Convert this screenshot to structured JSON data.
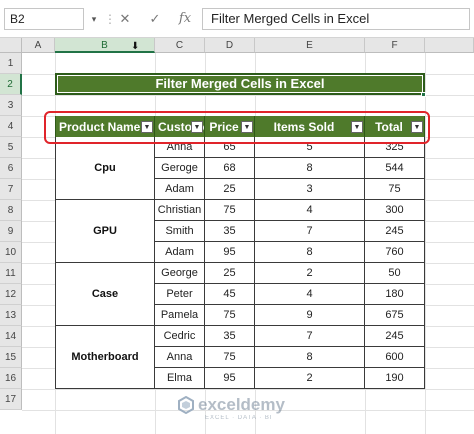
{
  "formula_bar": {
    "name_box": "B2",
    "cancel_symbol": "✕",
    "enter_symbol": "✓",
    "fx_symbol": "fx",
    "formula": "Filter Merged Cells in Excel"
  },
  "columns": [
    "A",
    "B",
    "C",
    "D",
    "E",
    "F"
  ],
  "rows": [
    "1",
    "2",
    "3",
    "4",
    "5",
    "6",
    "7",
    "8",
    "9",
    "10",
    "11",
    "12",
    "13",
    "14",
    "15",
    "16",
    "17"
  ],
  "title": "Filter Merged Cells in Excel",
  "table": {
    "headers": [
      "Product Name",
      "Customer",
      "Price",
      "Items Sold",
      "Total"
    ],
    "groups": [
      {
        "name": "Cpu",
        "rows": [
          [
            "Anna",
            "65",
            "5",
            "325"
          ],
          [
            "Geroge",
            "68",
            "8",
            "544"
          ],
          [
            "Adam",
            "25",
            "3",
            "75"
          ]
        ]
      },
      {
        "name": "GPU",
        "rows": [
          [
            "Christian",
            "75",
            "4",
            "300"
          ],
          [
            "Smith",
            "35",
            "7",
            "245"
          ],
          [
            "Adam",
            "95",
            "8",
            "760"
          ]
        ]
      },
      {
        "name": "Case",
        "rows": [
          [
            "George",
            "25",
            "2",
            "50"
          ],
          [
            "Peter",
            "45",
            "4",
            "180"
          ],
          [
            "Pamela",
            "75",
            "9",
            "675"
          ]
        ]
      },
      {
        "name": "Motherboard",
        "rows": [
          [
            "Cedric",
            "35",
            "7",
            "245"
          ],
          [
            "Anna",
            "75",
            "8",
            "600"
          ],
          [
            "Elma",
            "95",
            "2",
            "190"
          ]
        ]
      }
    ]
  },
  "watermark": {
    "name": "exceldemy",
    "tagline": "EXCEL · DATA · BI"
  },
  "colors": {
    "header_green": "#4f7a2b",
    "highlight_red": "#e0242a"
  }
}
